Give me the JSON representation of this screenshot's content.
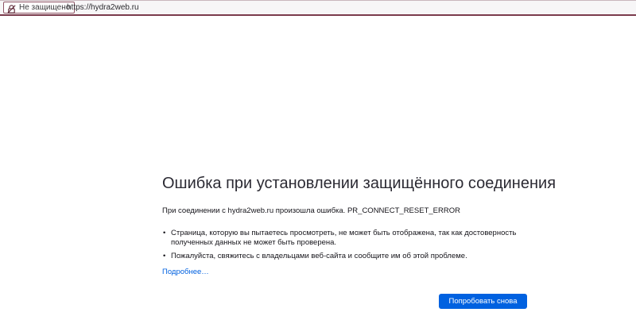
{
  "browser": {
    "security_label": "Не защищено",
    "security_icon": "broken-lock-icon",
    "url": "https://hydra2web.ru",
    "accent_color": "#7b3b4c"
  },
  "error": {
    "title": "Ошибка при установлении защищённого соединения",
    "intro": "При соединении с hydra2web.ru произошла ошибка. PR_CONNECT_RESET_ERROR",
    "bullets": [
      "Страница, которую вы пытаетесь просмотреть, не может быть отображена, так как достоверность полученных данных не может быть проверена.",
      "Пожалуйста, свяжитесь с владельцами веб-сайта и сообщите им об этой проблеме."
    ],
    "learn_more_label": "Подробнее…",
    "retry_label": "Попробовать снова",
    "button_color": "#0061e0"
  }
}
